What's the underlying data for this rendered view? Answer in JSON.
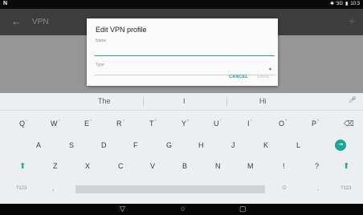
{
  "status": {
    "left_icon": "N",
    "signal": "3G",
    "battery": "▮",
    "time": "10:3"
  },
  "appbar": {
    "title": "VPN",
    "back_icon": "arrow-back-icon",
    "add_icon": "add-icon"
  },
  "dialog": {
    "title": "Edit VPN profile",
    "name_label": "Name",
    "name_value": "",
    "type_label": "Type",
    "type_value": "",
    "cancel_label": "CANCEL",
    "save_label": "SAVE"
  },
  "keyboard": {
    "suggestions": [
      "The",
      "I",
      "Hi"
    ],
    "row1": [
      {
        "k": "Q",
        "h": "1"
      },
      {
        "k": "W",
        "h": "2"
      },
      {
        "k": "E",
        "h": "3"
      },
      {
        "k": "R",
        "h": "4"
      },
      {
        "k": "T",
        "h": "5"
      },
      {
        "k": "Y",
        "h": "6"
      },
      {
        "k": "U",
        "h": "7"
      },
      {
        "k": "I",
        "h": "8"
      },
      {
        "k": "O",
        "h": "9"
      },
      {
        "k": "P",
        "h": "0"
      }
    ],
    "row2": [
      "A",
      "S",
      "D",
      "F",
      "G",
      "H",
      "J",
      "K",
      "L"
    ],
    "row3": [
      "Z",
      "X",
      "C",
      "V",
      "B",
      "N",
      "M",
      "!",
      "?"
    ],
    "symbols_left": "?123",
    "comma": ",",
    "emoji": "☺",
    "period": ".",
    "symbols_right": "?123"
  },
  "colors": {
    "accent": "#1ea494",
    "appbar": "#3d3d3d",
    "keyboard": "#eceff1"
  }
}
